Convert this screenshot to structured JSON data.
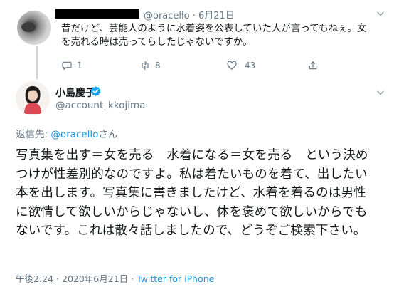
{
  "reply_tweet": {
    "handle": "@oracello",
    "separator": " · ",
    "date": "6月21日",
    "text": "昔だけど、芸能人のように水着姿を公表していた人が言ってもねぇ。女を売れる時は売ってらしたじゃないですか。",
    "actions": {
      "reply_count": "1",
      "retweet_count": "8",
      "like_count": "43"
    }
  },
  "main_tweet": {
    "author_name": "小島慶子",
    "author_handle": "@account_kkojima",
    "reply_to_prefix": "返信先: ",
    "reply_to_mention": "@oracello",
    "reply_to_suffix": "さん",
    "text": "写真集を出す＝女を売る　水着になる＝女を売る　という決めつけが性差別的なのですよ。私は着たいものを着て、出したい本を出します。写真集に書きましたけど、水着を着るのは男性に欲情して欲しいからじゃないし、体を褒めて欲しいからでもないです。これは散々話しましたので、どうぞご検索下さい。",
    "time": "午後2:24",
    "date": "2020年6月21日",
    "via": "Twitter for iPhone",
    "meta_separator": " · "
  },
  "colors": {
    "link": "#1b95e0",
    "secondary_text": "#657786",
    "verified": "#1da1f2"
  }
}
